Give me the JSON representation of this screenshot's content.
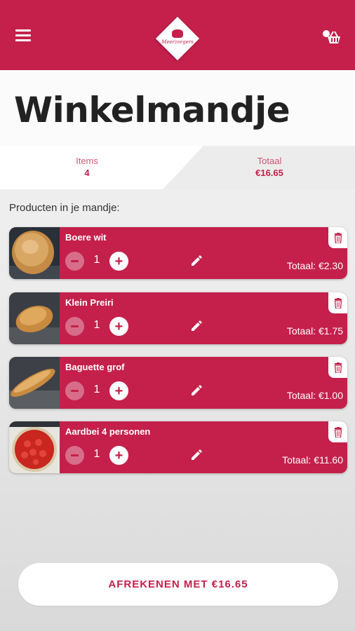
{
  "header": {
    "logo_text": "Meerzorgers",
    "menu_icon": "hamburger-menu-icon",
    "cart_icon": "basket-icon"
  },
  "page_title": "Winkelmandje",
  "summary": {
    "items_label": "Items",
    "items_value": "4",
    "total_label": "Totaal",
    "total_value": "€16.65"
  },
  "section_label": "Producten in je mandje:",
  "products": [
    {
      "name": "Boere wit",
      "quantity": "1",
      "total": "Totaal: €2.30",
      "image": "white-bread"
    },
    {
      "name": "Klein Preiri",
      "quantity": "1",
      "total": "Totaal: €1.75",
      "image": "small-bread"
    },
    {
      "name": "Baguette grof",
      "quantity": "1",
      "total": "Totaal: €1.00",
      "image": "baguette"
    },
    {
      "name": "Aardbei 4 personen",
      "quantity": "1",
      "total": "Totaal: €11.60",
      "image": "strawberry-tart"
    }
  ],
  "checkout_label": "AFREKENEN MET €16.65",
  "colors": {
    "brand": "#c4204b",
    "background": "#ececec",
    "surface": "#ffffff"
  }
}
